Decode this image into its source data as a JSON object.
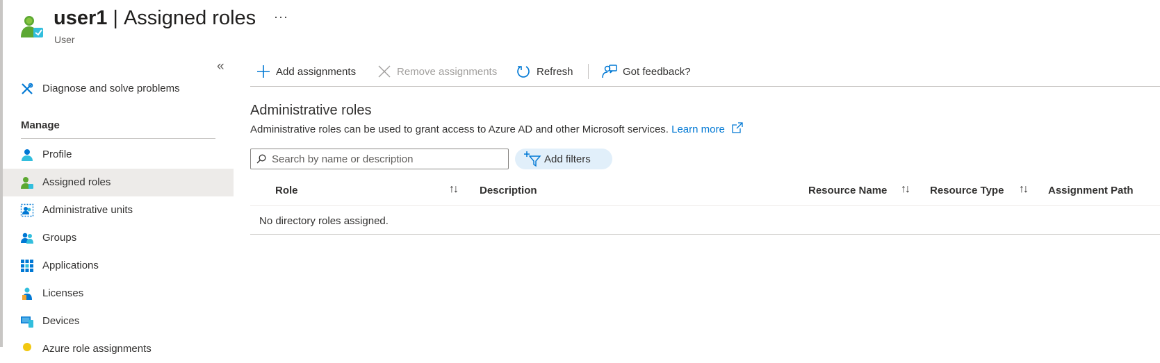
{
  "header": {
    "user_name": "user1",
    "separator": "|",
    "page_title": "Assigned roles",
    "subtitle": "User",
    "more_label": "···"
  },
  "sidebar": {
    "collapse_label": "«",
    "diagnose_label": "Diagnose and solve problems",
    "manage_heading": "Manage",
    "items": [
      {
        "label": "Profile",
        "icon": "profile-icon"
      },
      {
        "label": "Assigned roles",
        "icon": "assigned-roles-icon",
        "selected": true
      },
      {
        "label": "Administrative units",
        "icon": "administrative-units-icon"
      },
      {
        "label": "Groups",
        "icon": "groups-icon"
      },
      {
        "label": "Applications",
        "icon": "applications-icon"
      },
      {
        "label": "Licenses",
        "icon": "licenses-icon"
      },
      {
        "label": "Devices",
        "icon": "devices-icon"
      },
      {
        "label": "Azure role assignments",
        "icon": "azure-role-assignments-icon"
      }
    ]
  },
  "toolbar": {
    "add_label": "Add assignments",
    "remove_label": "Remove assignments",
    "refresh_label": "Refresh",
    "feedback_label": "Got feedback?"
  },
  "section": {
    "title": "Administrative roles",
    "description": "Administrative roles can be used to grant access to Azure AD and other Microsoft services.",
    "learn_more": "Learn more"
  },
  "search": {
    "placeholder": "Search by name or description",
    "value": ""
  },
  "filters": {
    "add_label": "Add filters"
  },
  "table": {
    "columns": [
      "Role",
      "Description",
      "Resource Name",
      "Resource Type",
      "Assignment Path"
    ],
    "sort_glyph": "↑↓",
    "empty_message": "No directory roles assigned."
  },
  "colors": {
    "accent": "#0078d4",
    "selected_bg": "#edebe9",
    "filter_pill_bg": "#e1effa",
    "disabled_text": "#a19f9d"
  }
}
